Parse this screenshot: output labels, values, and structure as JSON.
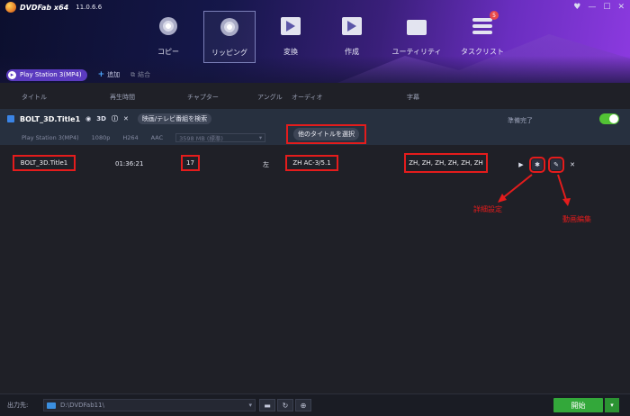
{
  "app": {
    "name": "DVDFab x64",
    "version": "11.0.6.6"
  },
  "window_controls": [
    "♥",
    "—",
    "☐",
    "✕"
  ],
  "nav": [
    {
      "label": "コピー",
      "icon": "disc-copy-icon"
    },
    {
      "label": "リッピング",
      "icon": "disc-rip-icon",
      "active": true
    },
    {
      "label": "変換",
      "icon": "film-convert-icon"
    },
    {
      "label": "作成",
      "icon": "film-create-icon"
    },
    {
      "label": "ユーティリティ",
      "icon": "folder-utility-icon"
    },
    {
      "label": "タスクリスト",
      "icon": "task-list-icon",
      "badge": "5"
    }
  ],
  "toolbar": {
    "device": "Play Station 3(MP4)",
    "add": "追加",
    "merge": "結合"
  },
  "columns": {
    "title": "タイトル",
    "duration": "再生時間",
    "chapters": "チャプター",
    "angle": "アングル",
    "audio": "オーディオ",
    "subtitles": "字幕"
  },
  "title_row": {
    "name": "BOLT_3D.Title1",
    "search_btn": "映画/テレビ番組を検索",
    "device": "Play Station 3(MP4)",
    "resolution": "1080p",
    "video_codec": "H264",
    "audio_codec": "AAC",
    "size": "3598 MB (標準)",
    "other_titles_btn": "他のタイトルを選択",
    "status": "準備完了"
  },
  "data_row": {
    "title": "BOLT_3D.Title1",
    "duration": "01:36:21",
    "chapters": "17",
    "angle": "左",
    "audio": "ZH  AC-3/5.1",
    "subtitles": "ZH, ZH, ZH, ZH, ZH, ZH"
  },
  "annotations": {
    "settings": "詳細設定",
    "video_edit": "動画編集"
  },
  "footer": {
    "output_label": "出力先:",
    "path": "D:\\DVDFab11\\",
    "start": "開始"
  },
  "colors": {
    "accent_red": "#e41c1c",
    "start_green": "#33a83a",
    "toggle_green": "#52c234",
    "device_purple": "#5b3bbf"
  }
}
